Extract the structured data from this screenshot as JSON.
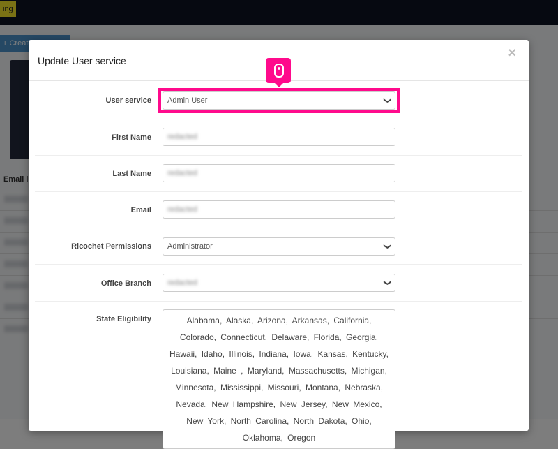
{
  "background": {
    "badge_text": "ing",
    "create_button": "Create",
    "email_column_header": "Email i"
  },
  "modal": {
    "title": "Update User service",
    "close_icon": "close-icon",
    "fields": {
      "user_service": {
        "label": "User service",
        "value": "Admin User"
      },
      "first_name": {
        "label": "First Name",
        "value": "redacted"
      },
      "last_name": {
        "label": "Last Name",
        "value": "redacted"
      },
      "email": {
        "label": "Email",
        "value": "redacted"
      },
      "ricochet_permissions": {
        "label": "Ricochet Permissions",
        "value": "Administrator"
      },
      "office_branch": {
        "label": "Office Branch",
        "value": "redacted"
      },
      "state_eligibility": {
        "label": "State Eligibility",
        "text": "Alabama, Alaska, Arizona, Arkansas, California, Colorado, Connecticut, Delaware, Florida, Georgia, Hawaii, Idaho, Illinois, Indiana, Iowa, Kansas, Kentucky, Louisiana, Maine , Maryland, Massachusetts, Michigan, Minnesota, Mississippi, Missouri, Montana, Nebraska, Nevada, New Hampshire, New Jersey, New Mexico, New York, North Carolina, North Dakota, Ohio, Oklahoma, Oregon"
      }
    }
  },
  "colors": {
    "highlight": "#ff0a8c",
    "topbar": "#0c1222"
  }
}
